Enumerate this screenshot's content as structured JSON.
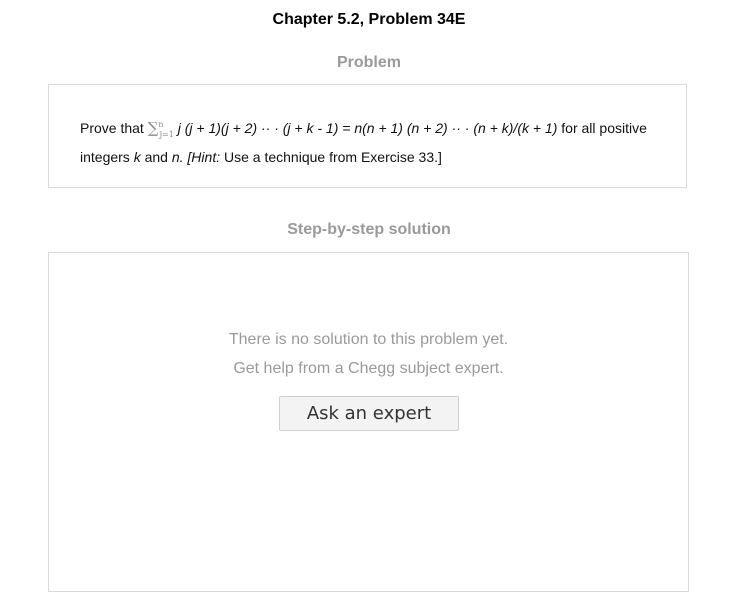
{
  "header": {
    "chapter_title": "Chapter 5.2, Problem 34E"
  },
  "problem": {
    "section_title": "Problem",
    "text": {
      "lead": "Prove that ",
      "sigma_symbol": "∑",
      "sigma_upper": "n",
      "sigma_lower": "j=1",
      "expression": " j (j + 1)(j + 2) ·· · (j + k - 1) = n(n + 1) (n + 2) ·· · (n + k)/(k + 1)",
      "tail_1": " for all positive integers ",
      "var_k": "k",
      "and": " and ",
      "var_n": "n.",
      "hint_label": " [Hint:",
      "hint_text": " Use a technique from Exercise 33.]"
    }
  },
  "solution": {
    "section_title": "Step-by-step solution",
    "empty_message_1": "There is no solution to this problem yet.",
    "empty_message_2": "Get help from a Chegg subject expert.",
    "ask_button_label": "Ask an expert"
  }
}
